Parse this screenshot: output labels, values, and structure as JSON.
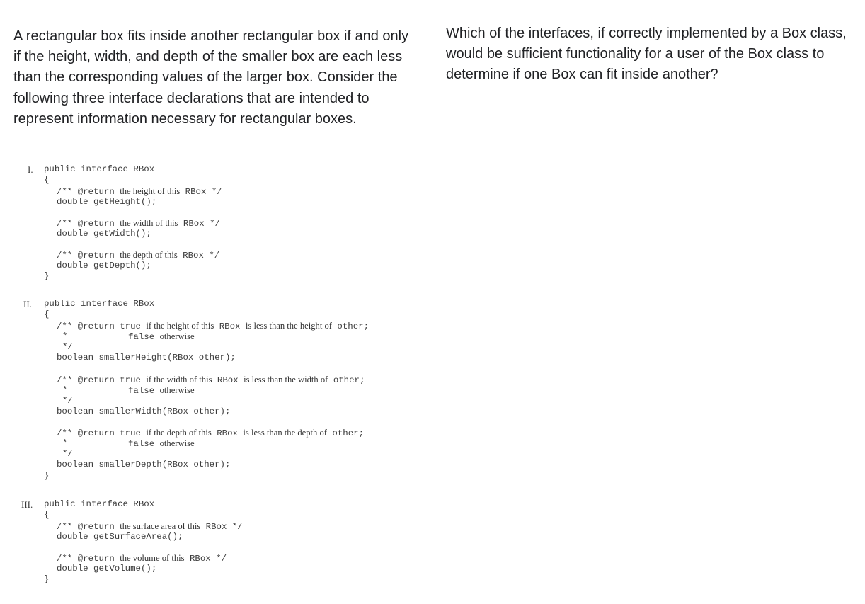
{
  "intro_text": "A rectangular box fits inside another rectangular box if and only if the height, width, and depth of the smaller box are each less than the corresponding values of the larger box. Consider the following three interface declarations that are intended to represent information necessary for rectangular boxes.",
  "question_text": "Which of the interfaces, if correctly implemented by a Box class, would be sufficient functionality for a user of the Box class to determine if one Box can fit inside another?",
  "interfaces": [
    {
      "numeral": "I.",
      "declaration": "public interface RBox",
      "open_brace": "{",
      "close_brace": "}",
      "items": [
        {
          "c1": "/** @return",
          "d1": "the height of this",
          "c2": "RBox",
          "d2": "",
          "c3": "*/",
          "rest": [],
          "method": "double getHeight();"
        },
        {
          "c1": "/** @return",
          "d1": "the width of this",
          "c2": "RBox",
          "d2": "",
          "c3": "*/",
          "rest": [],
          "method": "double getWidth();"
        },
        {
          "c1": "/** @return",
          "d1": "the depth of this",
          "c2": "RBox",
          "d2": "",
          "c3": "*/",
          "rest": [],
          "method": "double getDepth();"
        }
      ]
    },
    {
      "numeral": "II.",
      "declaration": "public interface RBox",
      "open_brace": "{",
      "close_brace": "}",
      "items": [
        {
          "c1": "/** @return true",
          "d1": "if the height of this",
          "c2": "RBox",
          "d2": "is less than the height of",
          "c3": "other;",
          "star": "*",
          "false_kw": "false",
          "otherwise": "otherwise",
          "end": "*/",
          "method": "boolean smallerHeight(RBox other);"
        },
        {
          "c1": "/** @return true",
          "d1": "if the width of this",
          "c2": "RBox",
          "d2": "is less than the width of",
          "c3": "other;",
          "star": "*",
          "false_kw": "false",
          "otherwise": "otherwise",
          "end": "*/",
          "method": "boolean smallerWidth(RBox other);"
        },
        {
          "c1": "/** @return true",
          "d1": "if the depth of this",
          "c2": "RBox",
          "d2": "is less than the depth of",
          "c3": "other;",
          "star": "*",
          "false_kw": "false",
          "otherwise": "otherwise",
          "end": "*/",
          "method": "boolean smallerDepth(RBox other);"
        }
      ]
    },
    {
      "numeral": "III.",
      "declaration": "public interface RBox",
      "open_brace": "{",
      "close_brace": "}",
      "items": [
        {
          "c1": "/** @return",
          "d1": "the surface area of this",
          "c2": "RBox",
          "d2": "",
          "c3": "*/",
          "method": "double getSurfaceArea();"
        },
        {
          "c1": "/** @return",
          "d1": "the volume of this",
          "c2": "RBox",
          "d2": "",
          "c3": "*/",
          "method": "double getVolume();"
        }
      ]
    }
  ]
}
